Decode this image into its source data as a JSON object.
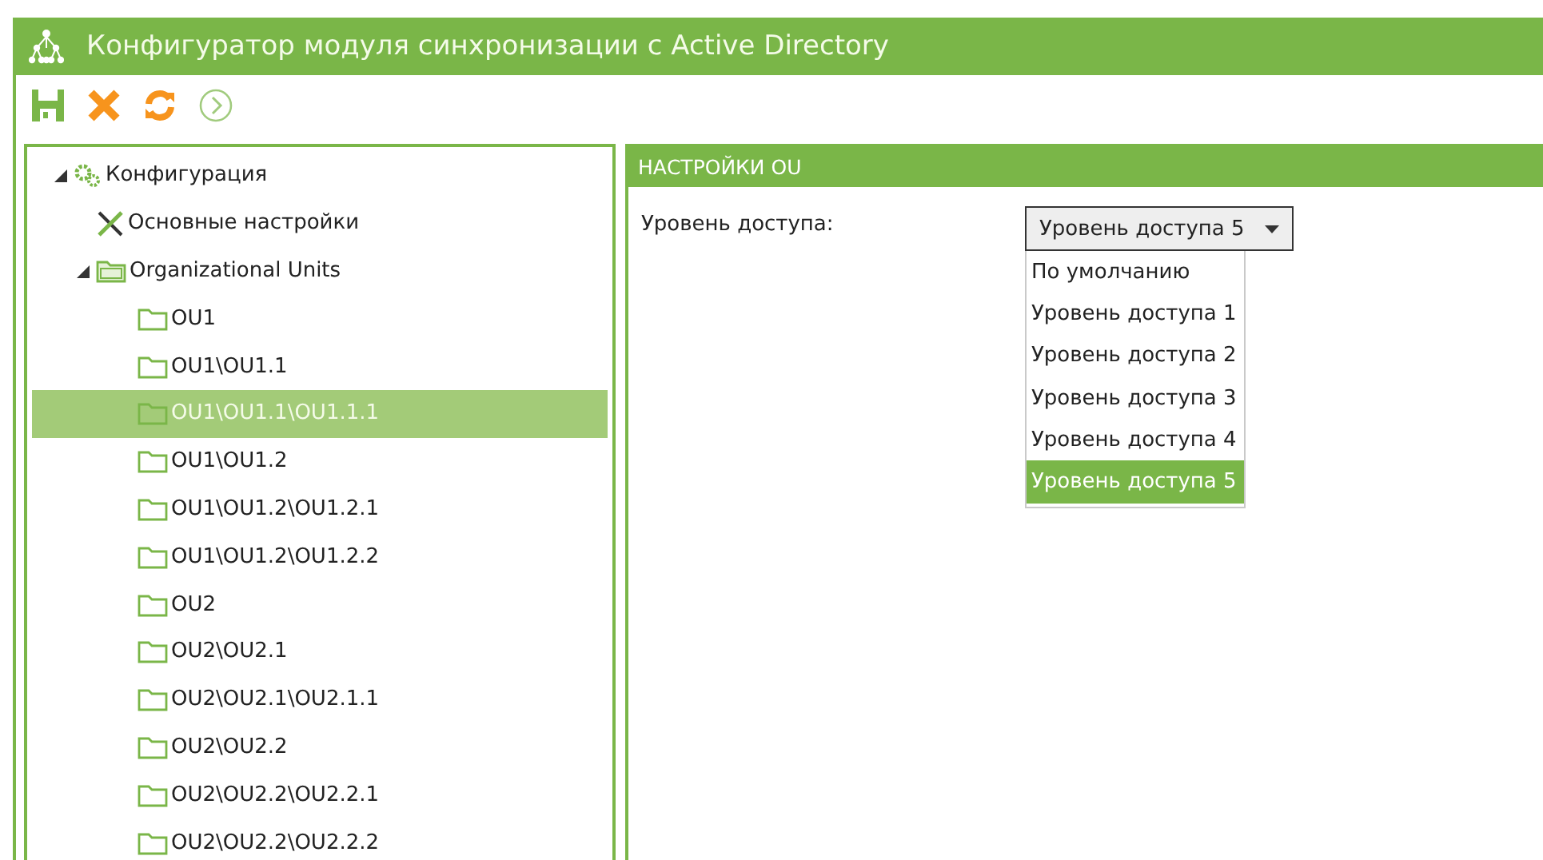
{
  "window": {
    "title": "Конфигуратор модуля синхронизации с Active Directory"
  },
  "toolbar": [
    {
      "kind": "save",
      "disabled": false
    },
    {
      "kind": "cancel",
      "disabled": false
    },
    {
      "kind": "refresh",
      "disabled": false
    },
    {
      "kind": "next",
      "disabled": true
    }
  ],
  "tree": [
    {
      "label": "Конфигурация",
      "kind": "config",
      "expanded": true,
      "selected": false,
      "children": [
        {
          "label": "Основные настройки",
          "kind": "settings",
          "selected": false
        },
        {
          "label": "Organizational Units",
          "kind": "folder-root",
          "expanded": true,
          "selected": false,
          "children": [
            {
              "label": "OU1",
              "kind": "folder",
              "selected": false
            },
            {
              "label": "OU1\\OU1.1",
              "kind": "folder",
              "selected": false
            },
            {
              "label": "OU1\\OU1.1\\OU1.1.1",
              "kind": "folder",
              "selected": true
            },
            {
              "label": "OU1\\OU1.2",
              "kind": "folder",
              "selected": false
            },
            {
              "label": "OU1\\OU1.2\\OU1.2.1",
              "kind": "folder",
              "selected": false
            },
            {
              "label": "OU1\\OU1.2\\OU1.2.2",
              "kind": "folder",
              "selected": false
            },
            {
              "label": "OU2",
              "kind": "folder",
              "selected": false
            },
            {
              "label": "OU2\\OU2.1",
              "kind": "folder",
              "selected": false
            },
            {
              "label": "OU2\\OU2.1\\OU2.1.1",
              "kind": "folder",
              "selected": false
            },
            {
              "label": "OU2\\OU2.2",
              "kind": "folder",
              "selected": false
            },
            {
              "label": "OU2\\OU2.2\\OU2.2.1",
              "kind": "folder",
              "selected": false
            },
            {
              "label": "OU2\\OU2.2\\OU2.2.2",
              "kind": "folder",
              "selected": false
            }
          ]
        }
      ]
    }
  ],
  "panel": {
    "title": "НАСТРОЙКИ OU",
    "field": {
      "label": "Уровень доступа:",
      "value": "Уровень доступа 5",
      "expanded": true,
      "options": [
        {
          "label": "По умолчанию",
          "selected": false
        },
        {
          "label": "Уровень доступа 1",
          "selected": false
        },
        {
          "label": "Уровень доступа 2",
          "selected": false
        },
        {
          "label": "Уровень доступа 3",
          "selected": false
        },
        {
          "label": "Уровень доступа 4",
          "selected": false
        },
        {
          "label": "Уровень доступа 5",
          "selected": true
        }
      ]
    }
  }
}
